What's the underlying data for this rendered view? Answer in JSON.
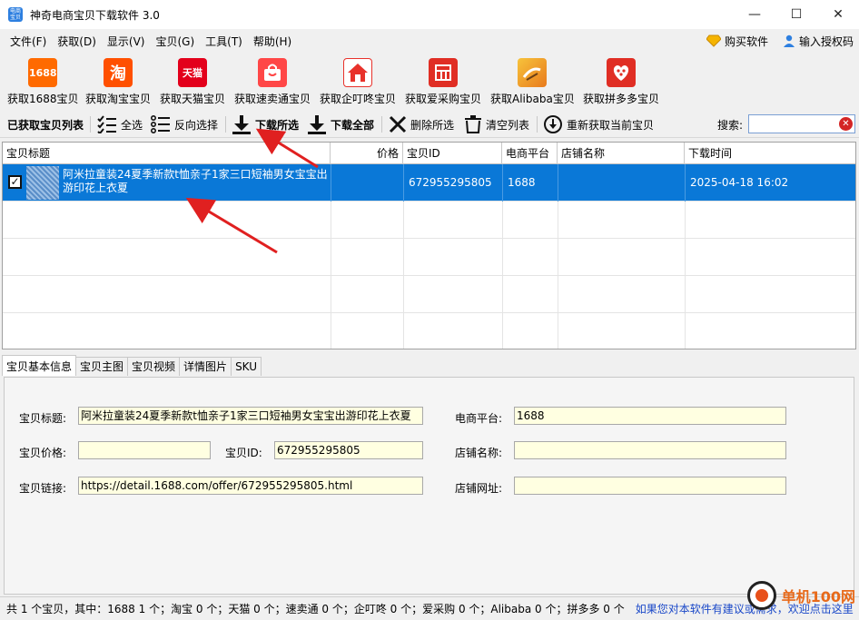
{
  "window": {
    "title": "神奇电商宝贝下载软件 3.0",
    "icon_text": "电商宝贝",
    "minimize": "—",
    "maximize": "☐",
    "close": "✕"
  },
  "menu": {
    "items": [
      "文件(F)",
      "获取(D)",
      "显示(V)",
      "宝贝(G)",
      "工具(T)",
      "帮助(H)"
    ],
    "buy": "购买软件",
    "auth": "输入授权码"
  },
  "platforms": [
    {
      "label": "获取1688宝贝",
      "icon": "1688",
      "color": "#ff6a00"
    },
    {
      "label": "获取淘宝宝贝",
      "icon": "淘",
      "color": "#ff5000"
    },
    {
      "label": "获取天猫宝贝",
      "icon": "天猫",
      "color": "#e3001b"
    },
    {
      "label": "获取速卖通宝贝",
      "icon": "",
      "color": "#ff4747"
    },
    {
      "label": "获取企叮咚宝贝",
      "icon": "",
      "color": "#e8322b"
    },
    {
      "label": "获取爱采购宝贝",
      "icon": "",
      "color": "#e02e24"
    },
    {
      "label": "获取Alibaba宝贝",
      "icon": "",
      "color": "#f5a623"
    },
    {
      "label": "获取拼多多宝贝",
      "icon": "",
      "color": "#e02e24"
    }
  ],
  "actions": {
    "list_title": "已获取宝贝列表",
    "select_all": "全选",
    "invert": "反向选择",
    "download_selected": "下载所选",
    "download_all": "下载全部",
    "delete_selected": "删除所选",
    "clear_list": "清空列表",
    "refetch": "重新获取当前宝贝",
    "search_label": "搜索:",
    "search_value": ""
  },
  "table": {
    "columns": [
      "宝贝标题",
      "价格",
      "宝贝ID",
      "电商平台",
      "店铺名称",
      "下载时间"
    ],
    "rows": [
      {
        "checked": "✓",
        "title": "阿米拉童装24夏季新款t恤亲子1家三口短袖男女宝宝出游印花上衣夏",
        "price": "",
        "id": "672955295805",
        "platform": "1688",
        "shop": "",
        "time": "2025-04-18 16:02"
      }
    ]
  },
  "tabs": [
    "宝贝基本信息",
    "宝贝主图",
    "宝贝视频",
    "详情图片",
    "SKU"
  ],
  "detail": {
    "title_label": "宝贝标题:",
    "title_value": "阿米拉童装24夏季新款t恤亲子1家三口短袖男女宝宝出游印花上衣夏",
    "platform_label": "电商平台:",
    "platform_value": "1688",
    "price_label": "宝贝价格:",
    "price_value": "",
    "id_label": "宝贝ID:",
    "id_value": "672955295805",
    "shop_label": "店铺名称:",
    "shop_value": "",
    "link_label": "宝贝链接:",
    "link_value": "https://detail.1688.com/offer/672955295805.html",
    "shop_url_label": "店铺网址:",
    "shop_url_value": ""
  },
  "status": {
    "text": "共 1 个宝贝，其中：1688 1 个；淘宝 0 个；天猫 0 个；速卖通 0 个；企叮咚 0 个；爱采购 0 个；Alibaba 0 个；拼多多 0 个",
    "link": "如果您对本软件有建议或需求，欢迎点击这里"
  },
  "watermark": "单机100网"
}
